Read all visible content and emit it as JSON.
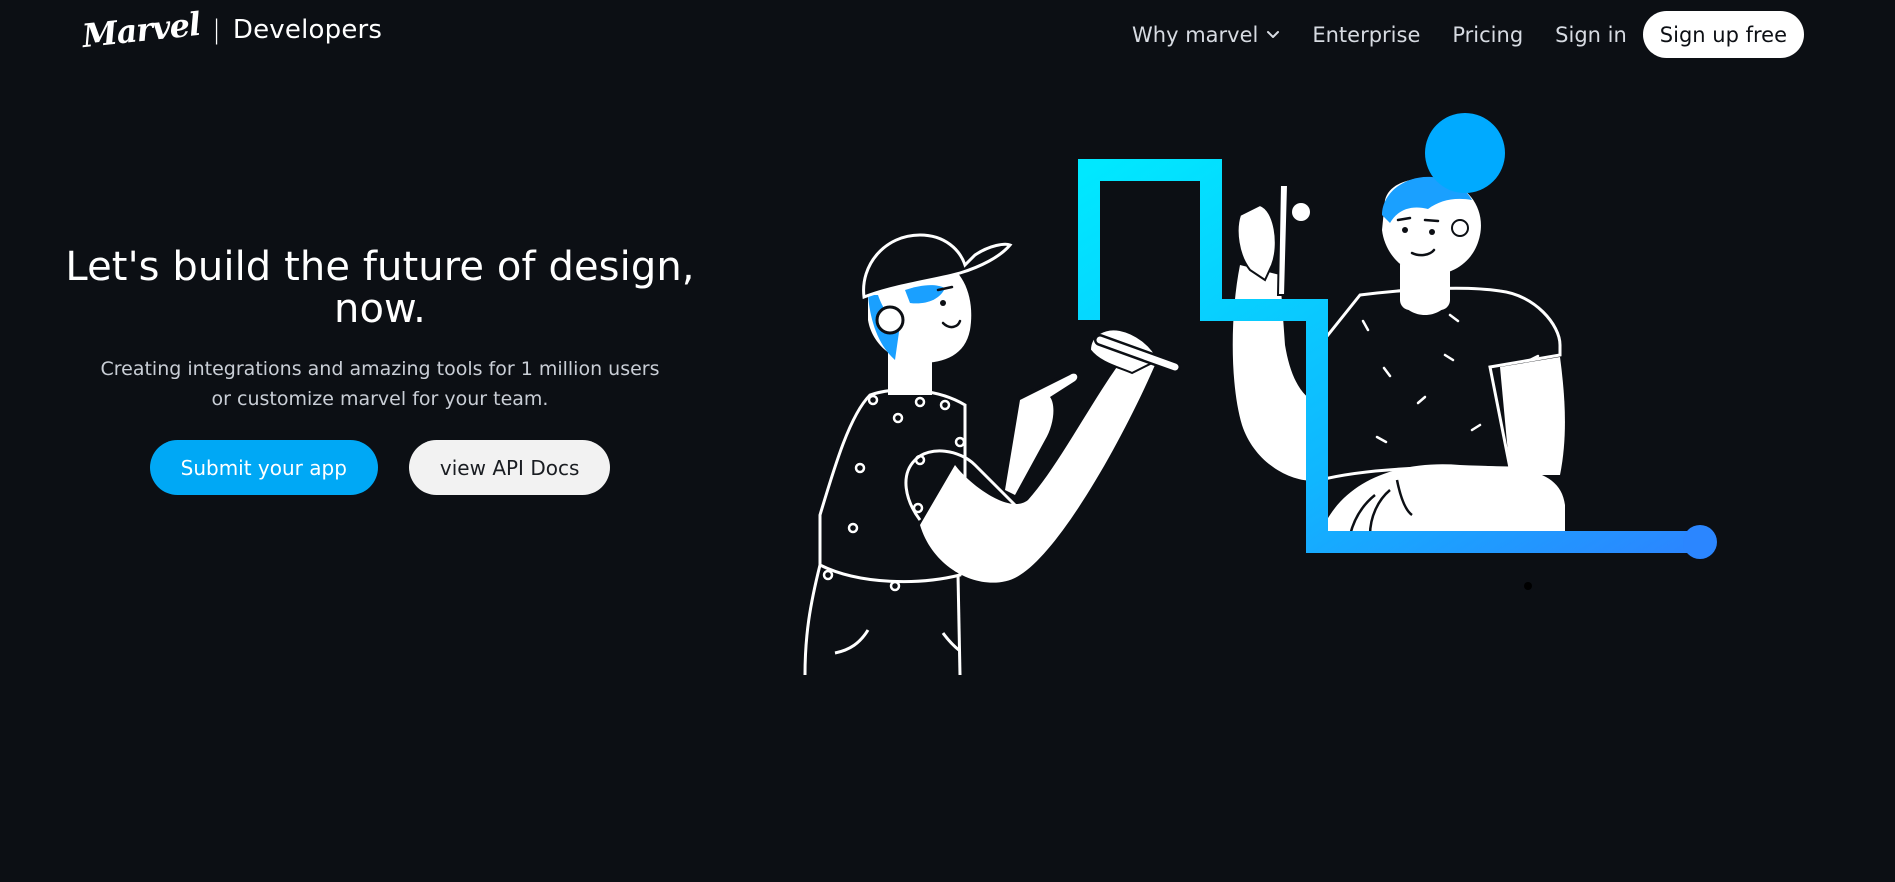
{
  "header": {
    "logo_text": "Marvel",
    "separator": "|",
    "product": "Developers",
    "nav": {
      "why_marvel": "Why marvel",
      "enterprise": "Enterprise",
      "pricing": "Pricing",
      "sign_in": "Sign in",
      "sign_up": "Sign up free"
    }
  },
  "hero": {
    "title_line1": "Let's build the future of design,",
    "title_line2": "now.",
    "subtitle_line1": "Creating integrations and amazing tools for 1 million users",
    "subtitle_line2": "or customize marvel for your team.",
    "primary_cta": "Submit your app",
    "secondary_cta": "view API Docs"
  },
  "icons": {
    "dropdown": "chevron-down-icon",
    "illustration": "two-people-drawing-illustration"
  },
  "colors": {
    "background": "#0c0f14",
    "accent": "#00a8f5",
    "accent_cyan": "#00e5ff",
    "accent_blue": "#2b86ff",
    "button_light": "#f2f2f2",
    "text_muted": "#c9ced6"
  }
}
